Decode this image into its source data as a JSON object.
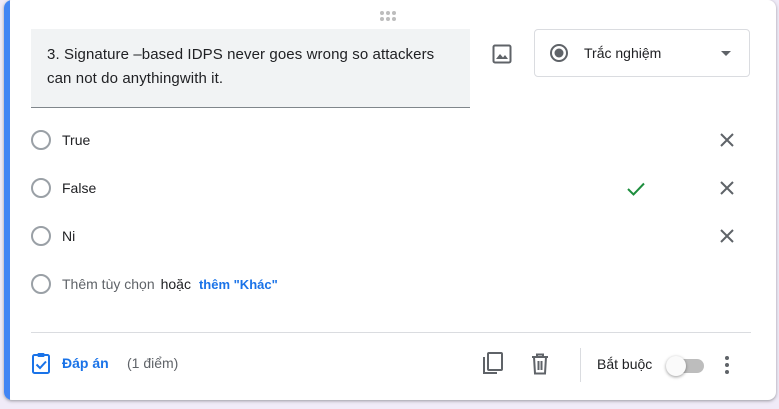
{
  "question": {
    "text": "3. Signature –based IDPS never goes wrong so attackers can not do anythingwith it."
  },
  "type_select": {
    "label": "Trắc nghiệm",
    "icon": "radio-button-icon"
  },
  "options": [
    {
      "label": "True",
      "correct": false
    },
    {
      "label": "False",
      "correct": true
    },
    {
      "label": "Ni",
      "correct": false
    }
  ],
  "add_option": {
    "label": "Thêm tùy chọn",
    "or_text": "hoặc",
    "add_other": "thêm \"Khác\""
  },
  "footer": {
    "answer_key_label": "Đáp án",
    "points": "(1 điểm)",
    "required_label": "Bắt buộc",
    "required": false
  },
  "colors": {
    "accent": "#4285f4",
    "link": "#1a73e8",
    "check": "#1e8e3e"
  }
}
